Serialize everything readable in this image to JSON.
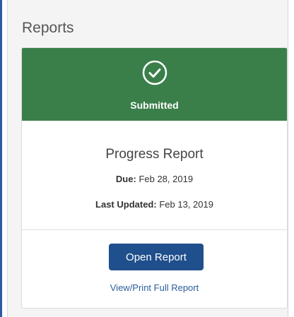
{
  "panel": {
    "title": "Reports"
  },
  "status": {
    "label": "Submitted",
    "icon": "check-circle-icon",
    "color": "#3a7f4a"
  },
  "report": {
    "name": "Progress Report",
    "due_label": "Due:",
    "due_value": "Feb 28, 2019",
    "updated_label": "Last Updated:",
    "updated_value": "Feb 13, 2019"
  },
  "actions": {
    "open_label": "Open Report",
    "print_label": "View/Print Full Report"
  },
  "colors": {
    "accent": "#1f4f8c",
    "link": "#2b5d9a"
  }
}
